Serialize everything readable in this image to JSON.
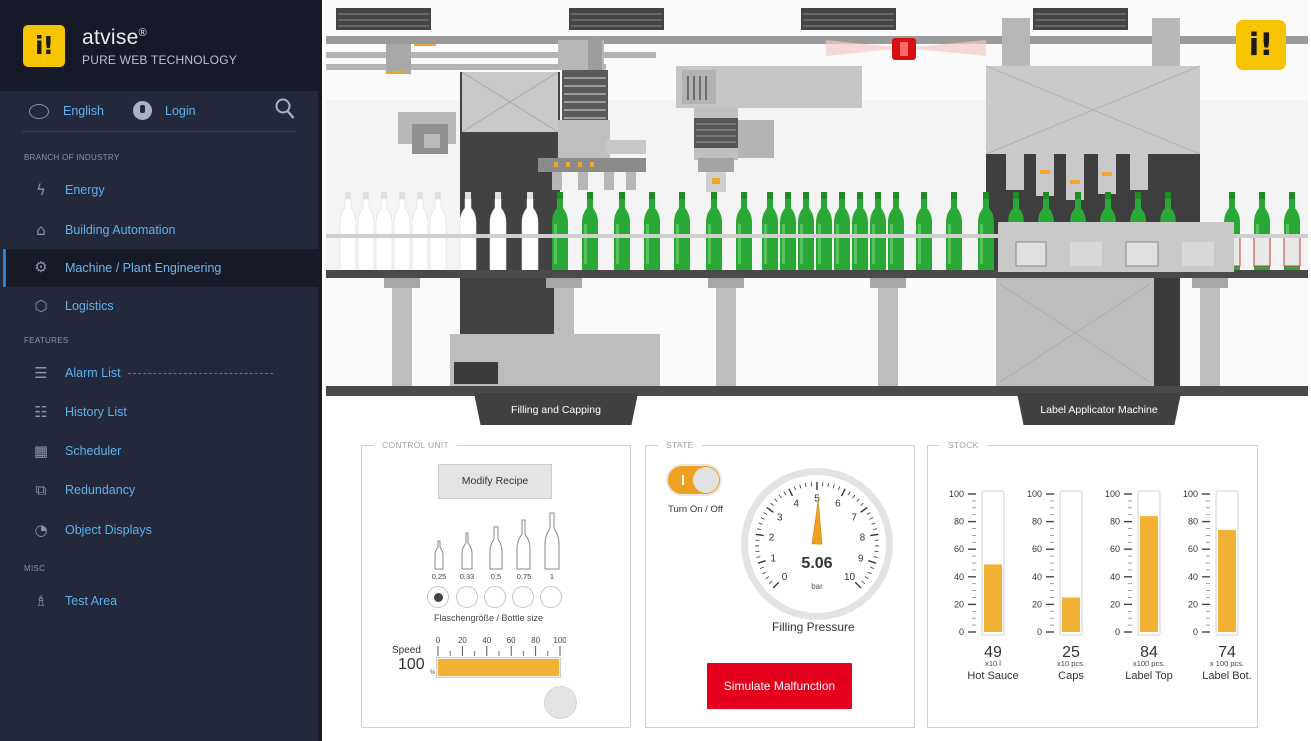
{
  "brand": {
    "logo_text": "i!",
    "name": "atvise",
    "reg_mark": "®",
    "tagline": "PURE WEB TECHNOLOGY"
  },
  "toolbar": {
    "language": "English",
    "login": "Login"
  },
  "nav": {
    "sections": [
      {
        "title": "BRANCH OF INDUSTRY"
      },
      {
        "title": "FEATURES"
      },
      {
        "title": "MISC"
      }
    ],
    "items": [
      {
        "label": "Energy",
        "icon": "lightning-icon"
      },
      {
        "label": "Building Automation",
        "icon": "house-icon"
      },
      {
        "label": "Machine / Plant Engineering",
        "icon": "gears-icon",
        "active": true
      },
      {
        "label": "Logistics",
        "icon": "box-icon"
      },
      {
        "label": "Alarm List",
        "icon": "alarm-list-icon"
      },
      {
        "label": "History List",
        "icon": "history-list-icon"
      },
      {
        "label": "Scheduler",
        "icon": "calendar-icon"
      },
      {
        "label": "Redundancy",
        "icon": "redundancy-icon"
      },
      {
        "label": "Object Displays",
        "icon": "gauge-icon"
      },
      {
        "label": "Test Area",
        "icon": "flask-icon"
      }
    ]
  },
  "scene": {
    "stations": [
      "Filling and Capping",
      "Label Applicator Machine"
    ],
    "colors": {
      "green_bottle": "#2aa836",
      "white_bottle": "#ffffff",
      "machine": "#b4b4b4",
      "dark_wall": "#404040"
    }
  },
  "control_unit": {
    "title": "CONTROL UNIT",
    "modify_button": "Modify Recipe",
    "bottle_sizes": [
      "0,25",
      "0,33",
      "0,5",
      "0,75",
      "1"
    ],
    "selected_size_index": 0,
    "bottle_size_caption": "Flaschengröße / Bottle size",
    "speed_label": "Speed",
    "speed_value": "100",
    "speed_unit": "%",
    "speed_fraction": 1.0,
    "speed_ticks": [
      "0",
      "20",
      "40",
      "60",
      "80",
      "100"
    ]
  },
  "state": {
    "title": "STATE",
    "toggle_on": true,
    "toggle_label": "Turn On / Off",
    "pressure_value": "5.06",
    "pressure_unit": "bar",
    "pressure_min": 0,
    "pressure_max": 10,
    "pressure_numeric": 5.06,
    "gauge_ticks": [
      "0",
      "1",
      "2",
      "3",
      "4",
      "5",
      "6",
      "7",
      "8",
      "9",
      "10"
    ],
    "pressure_label": "Filling Pressure",
    "malfunction_button": "Simulate Malfunction",
    "accent": "#f0a021",
    "alarm_red": "#e4001c"
  },
  "stock": {
    "title": "STOCK",
    "axis_ticks": [
      "100",
      "80",
      "60",
      "40",
      "20",
      "0"
    ],
    "items": [
      {
        "value": "49",
        "unit": "x10 l",
        "name": "Hot Sauce",
        "level": 49
      },
      {
        "value": "25",
        "unit": "x10 pcs.",
        "name": "Caps",
        "level": 25
      },
      {
        "value": "84",
        "unit": "x100 pcs.",
        "name": "Label Top",
        "level": 84
      },
      {
        "value": "74",
        "unit": "x 100 pcs.",
        "name": "Label Bot.",
        "level": 74
      }
    ]
  }
}
